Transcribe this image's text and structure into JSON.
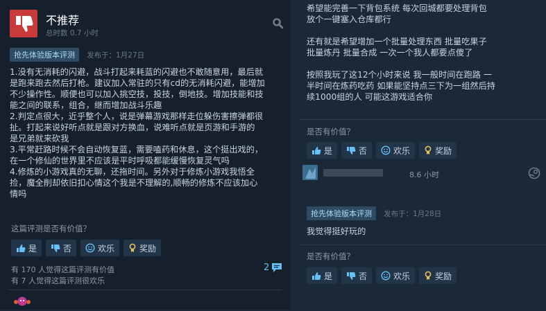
{
  "left_review": {
    "verdict": "不推荐",
    "hours": "总时数 0.7 小时",
    "badge": "抢先体验版本评测",
    "posted": "发布于：1月27日",
    "lines": [
      "1.没有无消耗的闪避，战斗打起来耗蓝的闪避也不敢随意用，最后就",
      "是跑来跑去然后打枪。建议加入常驻的只有cd的无消耗闪避，能增加",
      "不少操作性。顺便也可以加入挑空技，投技，倒地技。增加技能和技",
      "能之间的联系，组合，继而增加战斗乐趣",
      "2.判定点很大，近乎整个人，说是弹幕游戏那样走位躲伤害擦弹都很",
      "扯。打起来说好听点就是跟对方换血，说难听点就是页游和手游的",
      "是兄弟就来砍我",
      "3.平常赶路时候不会自动恢复蓝，需要嗑药和休息，这个挺出戏的，",
      "在一个修仙的世界里不应该是平时呼吸都能缓慢恢复灵气吗",
      "4.修炼的小游戏真的无聊，还拖时间。另外对于修炼小游戏我悟全",
      "捡，魔全削却依旧扣心情这个我是不理解的,顺畅的修炼不应该加心",
      "情吗"
    ],
    "helpful_q": "这篇评测是否有价值？",
    "buttons": {
      "yes": "是",
      "no": "否",
      "funny": "欢乐",
      "award": "奖励"
    },
    "helpful_count": "有 170 人觉得这篇评测有价值",
    "funny_count": "有 7 人觉得这篇评测很欢乐",
    "comments": "2"
  },
  "right_top": {
    "paragraphs": [
      [
        "希望能完善一下背包系统 每次回城都要处理背包",
        "放个一键塞入仓库都行"
      ],
      [
        "还有就是希望增加一个批量处理东西 批量吃果子",
        "批量炼丹 批量合成 一次一个我人都要点傻了"
      ],
      [
        "按照我玩了这12个小时来说 我一般时间在跑路 一",
        "半时间在炼药吃药 如果能坚持点三下为一组然后持",
        "续1000组的人 可能这游戏适合你"
      ]
    ],
    "helpful_q": "是否有价值？",
    "buttons": {
      "yes": "是",
      "no": "否",
      "funny": "欢乐",
      "award": "奖励"
    }
  },
  "right_review2": {
    "hours": "8.6 小时",
    "badge": "抢先体验版本评测",
    "posted": "发布于：1月28日",
    "text": "我觉得挺好玩的",
    "helpful_q": "是否有价值？",
    "buttons": {
      "yes": "是",
      "no": "否",
      "funny": "欢乐",
      "award": "奖励"
    }
  },
  "colors": {
    "background": "#1b2838",
    "card": "#16202d",
    "not_recommended": "#c93a3a",
    "link": "#66c0f4",
    "award": "#e5c25d"
  }
}
